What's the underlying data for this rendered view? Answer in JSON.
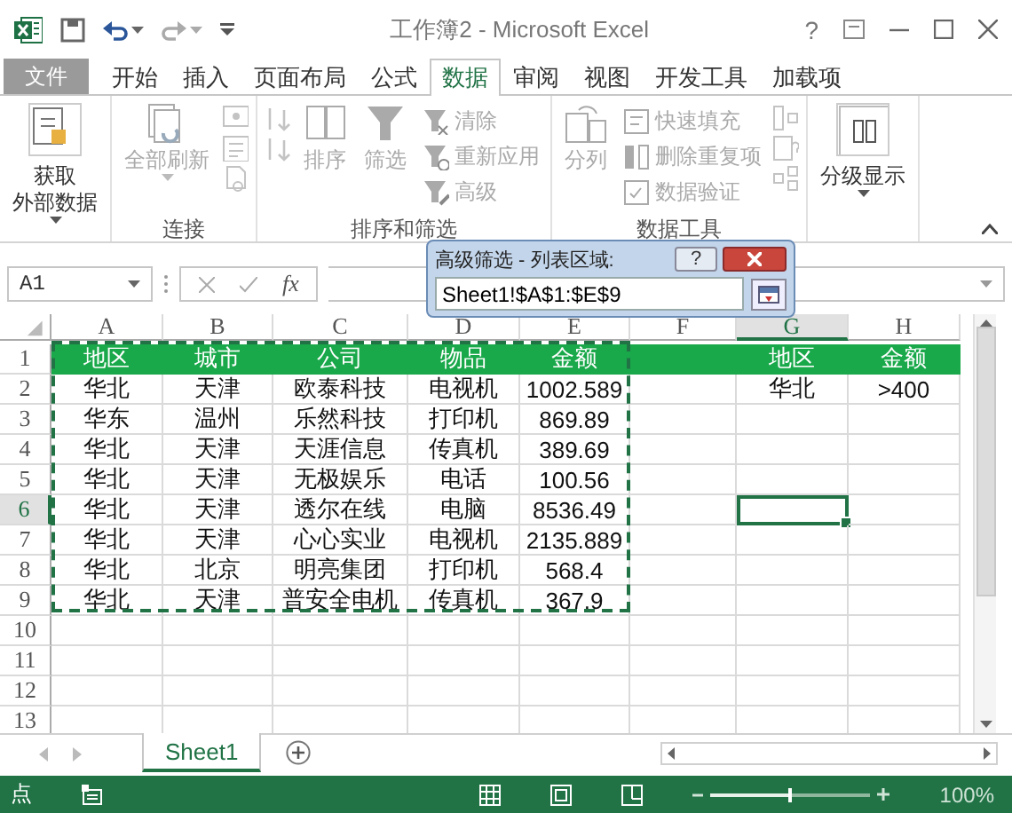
{
  "window": {
    "title": "工作簿2 - Microsoft Excel",
    "help": "?"
  },
  "quick_access": {
    "undo_disabled": false,
    "redo_disabled": true
  },
  "file_tab": {
    "label": "文件"
  },
  "tabs": [
    {
      "label": "开始",
      "selected": false
    },
    {
      "label": "插入",
      "selected": false
    },
    {
      "label": "页面布局",
      "selected": false
    },
    {
      "label": "公式",
      "selected": false
    },
    {
      "label": "数据",
      "selected": true
    },
    {
      "label": "审阅",
      "selected": false
    },
    {
      "label": "视图",
      "selected": false
    },
    {
      "label": "开发工具",
      "selected": false
    },
    {
      "label": "加载项",
      "selected": false
    }
  ],
  "ribbon": {
    "groups": [
      {
        "items": [
          {
            "kind": "large",
            "lines": [
              "获取",
              "外部数据"
            ],
            "dropdown": true,
            "disabled": false
          }
        ]
      },
      {
        "label": "连接",
        "items": [
          {
            "kind": "large",
            "lines": [
              "全部刷新"
            ],
            "dropdown": true,
            "disabled": true
          },
          {
            "kind": "icon",
            "disabled": true
          },
          {
            "kind": "icon",
            "disabled": true
          },
          {
            "kind": "icon",
            "disabled": true
          }
        ]
      },
      {
        "label": "排序和筛选",
        "items": [
          {
            "kind": "icon",
            "disabled": true
          },
          {
            "kind": "icon",
            "disabled": true
          },
          {
            "kind": "large",
            "lines": [
              "排序"
            ],
            "dropdown": false,
            "disabled": true
          },
          {
            "kind": "large",
            "lines": [
              "筛选"
            ],
            "dropdown": false,
            "disabled": true
          },
          {
            "kind": "small",
            "label": "清除",
            "disabled": true
          },
          {
            "kind": "small",
            "label": "重新应用",
            "disabled": true
          },
          {
            "kind": "small",
            "label": "高级",
            "disabled": true
          }
        ]
      },
      {
        "label": "数据工具",
        "items": [
          {
            "kind": "large",
            "lines": [
              "分列"
            ],
            "dropdown": false,
            "disabled": true
          },
          {
            "kind": "small",
            "label": "快速填充",
            "disabled": true
          },
          {
            "kind": "small",
            "label": "删除重复项",
            "disabled": true
          },
          {
            "kind": "small",
            "label": "数据验证",
            "disabled": true
          },
          {
            "kind": "icon",
            "disabled": true
          },
          {
            "kind": "icon",
            "disabled": true
          },
          {
            "kind": "icon",
            "disabled": true
          }
        ]
      },
      {
        "items": [
          {
            "kind": "large",
            "lines": [
              "分级显示"
            ],
            "dropdown": true,
            "disabled": false
          }
        ]
      }
    ]
  },
  "formula_bar": {
    "name_box": "A1",
    "fx": "fx"
  },
  "dialog": {
    "title": "高级筛选 - 列表区域:",
    "help": "?",
    "value": "Sheet1!$A$1:$E$9"
  },
  "grid": {
    "range_marquee": true,
    "columns": [
      {
        "label": "A",
        "selected": false
      },
      {
        "label": "B",
        "selected": false
      },
      {
        "label": "C",
        "selected": false
      },
      {
        "label": "D",
        "selected": false
      },
      {
        "label": "E",
        "selected": false
      },
      {
        "label": "F",
        "selected": false
      },
      {
        "label": "G",
        "selected": true
      },
      {
        "label": "H",
        "selected": false
      }
    ],
    "rows": [
      {
        "header": "1",
        "kind": "header",
        "selected": false,
        "cells": [
          "地区",
          "城市",
          "公司",
          "物品",
          "金额",
          "",
          "地区",
          "金额"
        ]
      },
      {
        "header": "2",
        "kind": "data",
        "selected": false,
        "cells": [
          "华北",
          "天津",
          "欧泰科技",
          "电视机",
          "1002.589",
          "",
          "华北",
          ">400"
        ]
      },
      {
        "header": "3",
        "kind": "data",
        "selected": false,
        "cells": [
          "华东",
          "温州",
          "乐然科技",
          "打印机",
          "869.89",
          "",
          "",
          ""
        ]
      },
      {
        "header": "4",
        "kind": "data",
        "selected": false,
        "cells": [
          "华北",
          "天津",
          "天涯信息",
          "传真机",
          "389.69",
          "",
          "",
          ""
        ]
      },
      {
        "header": "5",
        "kind": "data",
        "selected": false,
        "cells": [
          "华北",
          "天津",
          "无极娱乐",
          "电话",
          "100.56",
          "",
          "",
          ""
        ]
      },
      {
        "header": "6",
        "kind": "data",
        "selected": true,
        "cells": [
          "华北",
          "天津",
          "透尔在线",
          "电脑",
          "8536.49",
          "",
          "",
          ""
        ]
      },
      {
        "header": "7",
        "kind": "data",
        "selected": false,
        "cells": [
          "华北",
          "天津",
          "心心实业",
          "电视机",
          "2135.889",
          "",
          "",
          ""
        ]
      },
      {
        "header": "8",
        "kind": "data",
        "selected": false,
        "cells": [
          "华北",
          "北京",
          "明亮集团",
          "打印机",
          "568.4",
          "",
          "",
          ""
        ]
      },
      {
        "header": "9",
        "kind": "data",
        "selected": false,
        "cells": [
          "华北",
          "天津",
          "普安全电机",
          "传真机",
          "367.9",
          "",
          "",
          ""
        ]
      },
      {
        "header": "10",
        "kind": "data",
        "selected": false,
        "cells": [
          "",
          "",
          "",
          "",
          "",
          "",
          "",
          ""
        ]
      },
      {
        "header": "11",
        "kind": "data",
        "selected": false,
        "cells": [
          "",
          "",
          "",
          "",
          "",
          "",
          "",
          ""
        ]
      },
      {
        "header": "12",
        "kind": "data",
        "selected": false,
        "cells": [
          "",
          "",
          "",
          "",
          "",
          "",
          "",
          ""
        ]
      },
      {
        "header": "13",
        "kind": "data",
        "selected": false,
        "cells": [
          "",
          "",
          "",
          "",
          "",
          "",
          "",
          ""
        ]
      }
    ]
  },
  "sheet_tabs": [
    {
      "label": "Sheet1",
      "selected": true
    }
  ],
  "status_bar": {
    "mode": "点",
    "zoom": {
      "level": 0.5
    },
    "zoom_text": "100%"
  }
}
